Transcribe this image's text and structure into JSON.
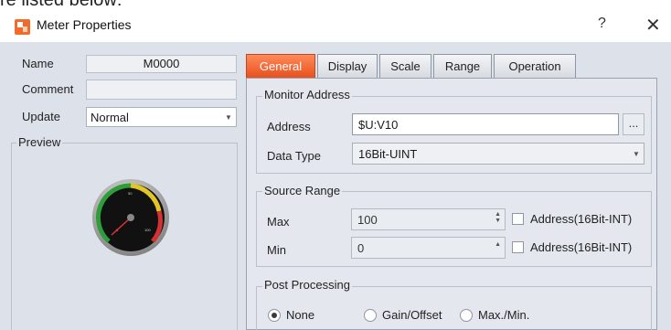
{
  "top_partial_text": "re listed below:",
  "window": {
    "title": "Meter Properties",
    "help": "?",
    "close": "✕"
  },
  "left": {
    "name_label": "Name",
    "name_value": "M0000",
    "comment_label": "Comment",
    "comment_value": "",
    "update_label": "Update",
    "update_value": "Normal",
    "preview_label": "Preview"
  },
  "tabs": [
    "General",
    "Display",
    "Scale",
    "Range",
    "Operation"
  ],
  "active_tab": "General",
  "monitor": {
    "legend": "Monitor Address",
    "address_label": "Address",
    "address_value": "$U:V10",
    "browse": "...",
    "datatype_label": "Data Type",
    "datatype_value": "16Bit-UINT"
  },
  "source": {
    "legend": "Source Range",
    "max_label": "Max",
    "max_value": "100",
    "min_label": "Min",
    "min_value": "0",
    "max_check_label": "Address(16Bit-INT)",
    "min_check_label": "Address(16Bit-INT)"
  },
  "post": {
    "legend": "Post Processing",
    "options": [
      "None",
      "Gain/Offset",
      "Max./Min."
    ],
    "selected": "None"
  },
  "colors": {
    "accent": "#e8501e",
    "dialog_bg": "#dde2ea",
    "panel_bg": "#e4e8ee"
  }
}
